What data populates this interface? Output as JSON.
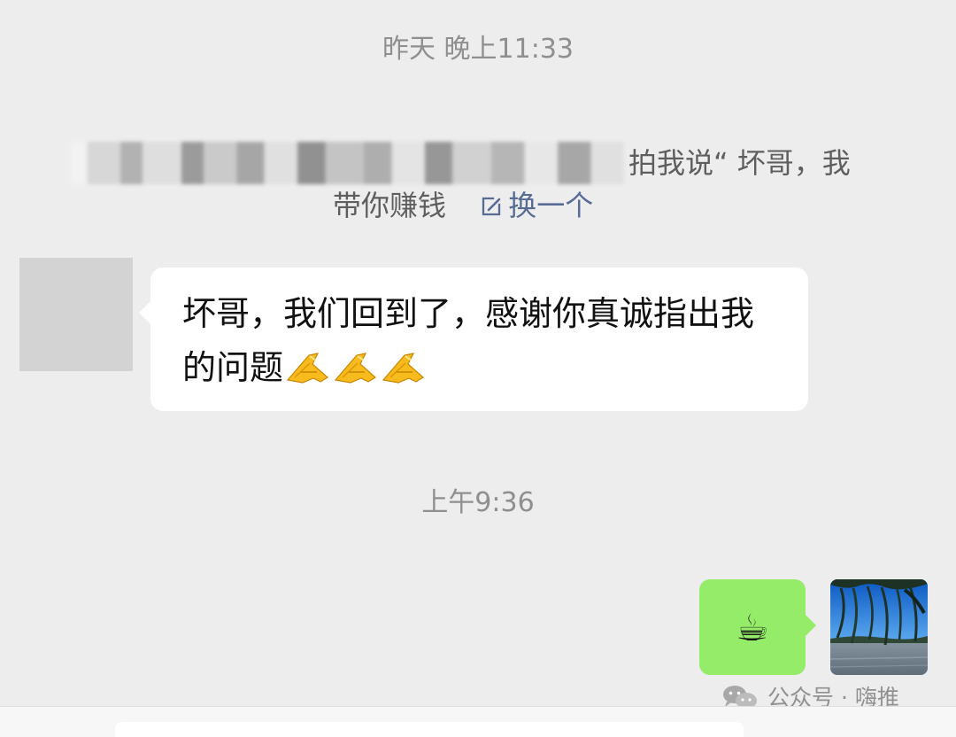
{
  "conversation": {
    "timestamp_1": "昨天 晚上11:33",
    "system_tip": {
      "line1": "拍我说“ 坏哥，我",
      "line2": "带你赚钱",
      "edit_link": "换一个",
      "edit_icon": "edit-box-icon"
    },
    "incoming_message": {
      "text": "坏哥，我们回到了，感谢你真诚指出我的问题",
      "emoji": "folded-hands-emoji",
      "emoji_count": 3
    },
    "timestamp_2": "上午9:36",
    "outgoing_message": {
      "emoji": "☕",
      "emoji_name": "coffee-emoji"
    },
    "watermark": {
      "icon": "wechat-icon",
      "text": "公众号 · 嗨推"
    }
  },
  "colors": {
    "background": "#ededed",
    "incoming_bubble": "#ffffff",
    "outgoing_bubble": "#95ec69",
    "link": "#576b95",
    "timestamp": "#8f8f8f"
  }
}
